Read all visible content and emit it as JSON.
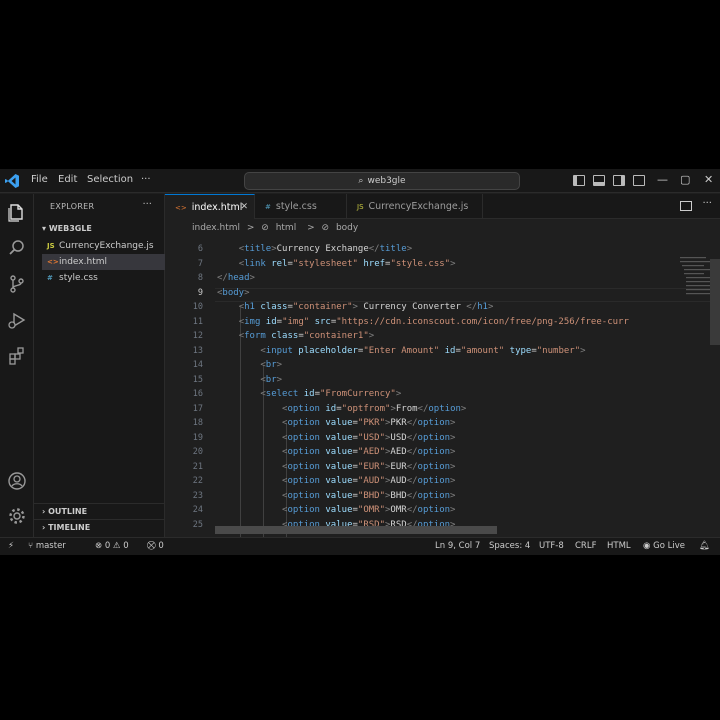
{
  "titlebar": {
    "menus": [
      "File",
      "Edit",
      "Selection",
      "···"
    ],
    "search_text": "web3gle",
    "window_controls": [
      "—",
      "▢",
      "✕"
    ]
  },
  "sidebar": {
    "header": "EXPLORER",
    "more": "···",
    "folder": "WEB3GLE",
    "files": [
      {
        "icon": "JS",
        "name": "CurrencyExchange.js",
        "color": "#cbcb41"
      },
      {
        "icon": "<>",
        "name": "index.html",
        "color": "#e37933"
      },
      {
        "icon": "#",
        "name": "style.css",
        "color": "#519aba"
      }
    ],
    "outline": "OUTLINE",
    "timeline": "TIMELINE"
  },
  "tabs": [
    {
      "icon": "<>",
      "label": "index.html",
      "color": "#e37933"
    },
    {
      "icon": "#",
      "label": "style.css",
      "color": "#519aba"
    },
    {
      "icon": "JS",
      "label": "CurrencyExchange.js",
      "color": "#cbcb41"
    }
  ],
  "breadcrumb": [
    "index.html",
    ">",
    "html",
    ">",
    "body"
  ],
  "editor": {
    "line_numbers": [
      "6",
      "7",
      "8",
      "9",
      "10",
      "11",
      "12",
      "13",
      "14",
      "15",
      "16",
      "17",
      "18",
      "19",
      "20",
      "21",
      "22",
      "23",
      "24",
      "25"
    ],
    "current_line": "9"
  },
  "statusbar": {
    "branch": "master",
    "problems": "⊗ 0 ⚠ 0",
    "ports": "0",
    "position": "Ln 9, Col 7",
    "spaces": "Spaces: 4",
    "encoding": "UTF-8",
    "eol": "CRLF",
    "language": "HTML",
    "golive": "Go Live"
  },
  "colors": {
    "accent": "#0078d4",
    "tag": "#569cd6",
    "attr": "#9cdcfe",
    "string": "#ce9178",
    "text": "#d4d4d4"
  }
}
